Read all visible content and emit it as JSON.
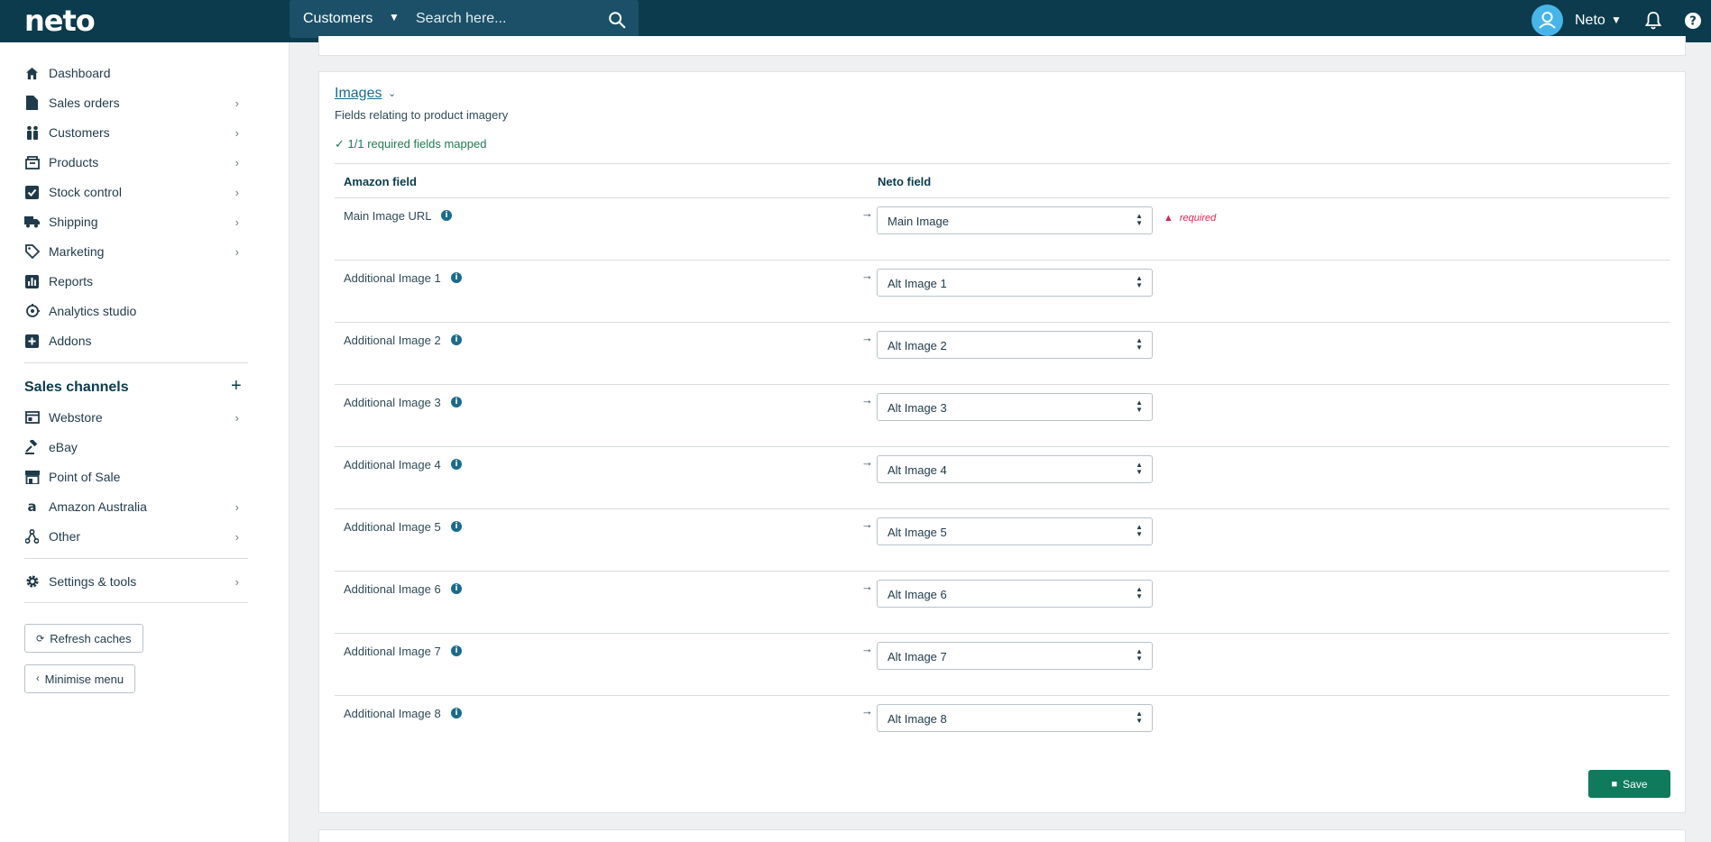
{
  "header": {
    "logo": "neto",
    "search_scope": "Customers",
    "search_placeholder": "Search here...",
    "user_name": "Neto"
  },
  "sidebar": {
    "items": [
      {
        "label": "Dashboard",
        "icon": "home-icon",
        "has_children": false
      },
      {
        "label": "Sales orders",
        "icon": "document-icon",
        "has_children": true
      },
      {
        "label": "Customers",
        "icon": "people-icon",
        "has_children": true
      },
      {
        "label": "Products",
        "icon": "box-icon",
        "has_children": true
      },
      {
        "label": "Stock control",
        "icon": "checkbox-icon",
        "has_children": true
      },
      {
        "label": "Shipping",
        "icon": "truck-icon",
        "has_children": true
      },
      {
        "label": "Marketing",
        "icon": "tag-icon",
        "has_children": true
      },
      {
        "label": "Reports",
        "icon": "chart-icon",
        "has_children": false
      },
      {
        "label": "Analytics studio",
        "icon": "analytics-icon",
        "has_children": false
      },
      {
        "label": "Addons",
        "icon": "plus-box-icon",
        "has_children": false
      }
    ],
    "channels_title": "Sales channels",
    "channels": [
      {
        "label": "Webstore",
        "icon": "browser-icon",
        "has_children": true
      },
      {
        "label": "eBay",
        "icon": "gavel-icon",
        "has_children": false
      },
      {
        "label": "Point of Sale",
        "icon": "store-icon",
        "has_children": false
      },
      {
        "label": "Amazon Australia",
        "icon": "amazon-icon",
        "has_children": true
      },
      {
        "label": "Other",
        "icon": "network-icon",
        "has_children": true
      }
    ],
    "settings": {
      "label": "Settings & tools",
      "icon": "gear-icon"
    },
    "refresh_label": "Refresh caches",
    "minimise_label": "Minimise menu"
  },
  "section": {
    "title": "Images",
    "description": "Fields relating to product imagery",
    "mapped_status": "1/1 required fields mapped",
    "col_amazon": "Amazon field",
    "col_neto": "Neto field",
    "required_label": "required",
    "save_label": "Save",
    "rows": [
      {
        "amazon": "Main Image URL",
        "neto": "Main Image",
        "required": true
      },
      {
        "amazon": "Additional Image 1",
        "neto": "Alt Image 1",
        "required": false
      },
      {
        "amazon": "Additional Image 2",
        "neto": "Alt Image 2",
        "required": false
      },
      {
        "amazon": "Additional Image 3",
        "neto": "Alt Image 3",
        "required": false
      },
      {
        "amazon": "Additional Image 4",
        "neto": "Alt Image 4",
        "required": false
      },
      {
        "amazon": "Additional Image 5",
        "neto": "Alt Image 5",
        "required": false
      },
      {
        "amazon": "Additional Image 6",
        "neto": "Alt Image 6",
        "required": false
      },
      {
        "amazon": "Additional Image 7",
        "neto": "Alt Image 7",
        "required": false
      },
      {
        "amazon": "Additional Image 8",
        "neto": "Alt Image 8",
        "required": false
      }
    ]
  }
}
